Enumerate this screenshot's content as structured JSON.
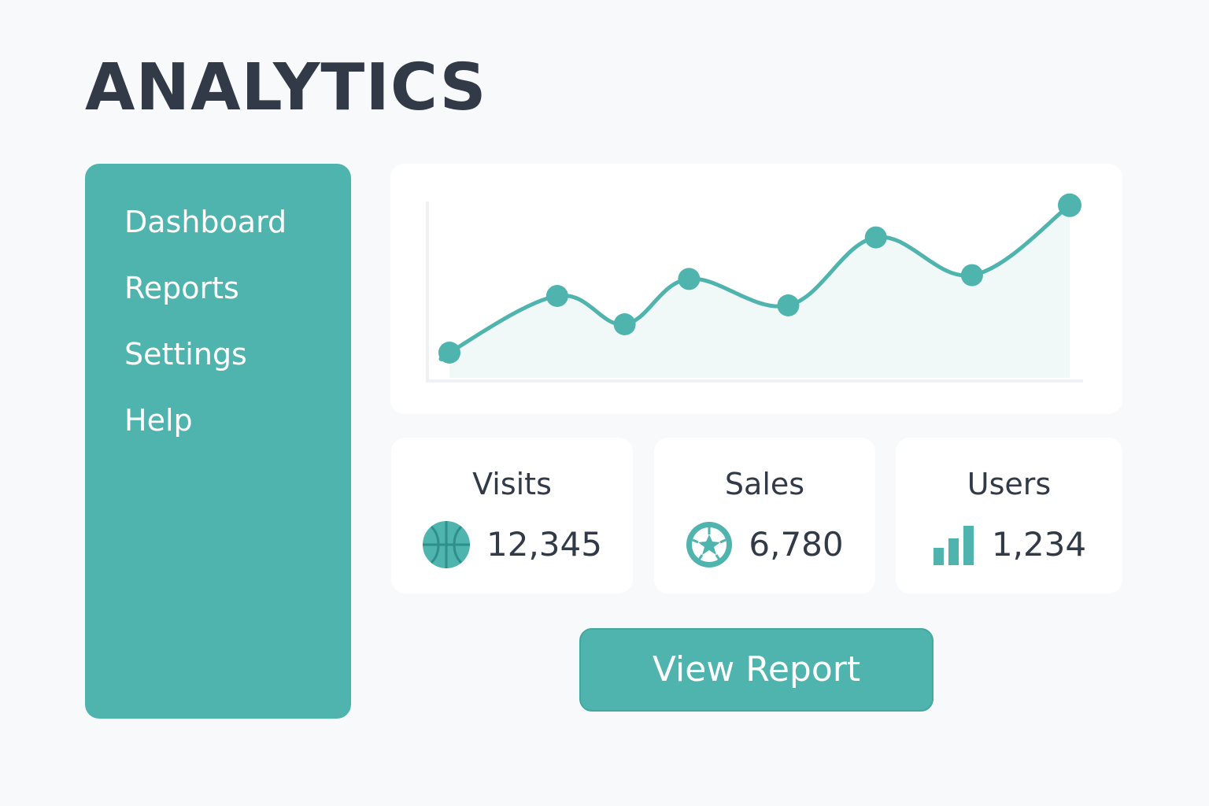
{
  "page": {
    "title": "ANALYTICS"
  },
  "sidebar": {
    "items": [
      {
        "label": "Dashboard"
      },
      {
        "label": "Reports"
      },
      {
        "label": "Settings"
      },
      {
        "label": "Help"
      }
    ]
  },
  "chart_data": {
    "type": "line",
    "title": "",
    "xlabel": "",
    "ylabel": "",
    "x": [
      1,
      2,
      3,
      4,
      5,
      6,
      7,
      8,
      9
    ],
    "series": [
      {
        "values": [
          15,
          45,
          30,
          54,
          40,
          76,
          56,
          93
        ]
      }
    ],
    "line_start": 12,
    "ylim": [
      0,
      100
    ],
    "grid": false,
    "legend": "none",
    "fill_under": true
  },
  "stats": [
    {
      "label": "Visits",
      "value": "12,345",
      "icon": "basketball-icon"
    },
    {
      "label": "Sales",
      "value": "6,780",
      "icon": "soccer-ball-icon"
    },
    {
      "label": "Users",
      "value": "1,234",
      "icon": "bar-chart-icon"
    }
  ],
  "actions": {
    "view_report_label": "View Report"
  },
  "colors": {
    "accent": "#4fb3ae",
    "text": "#323a48",
    "background": "#f7f9fb",
    "card": "#ffffff"
  }
}
